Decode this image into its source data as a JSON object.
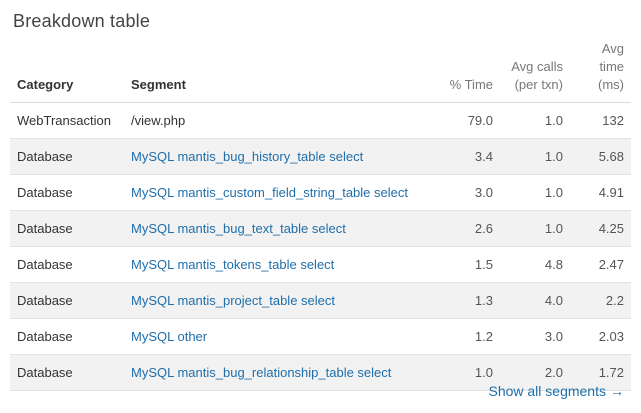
{
  "title": "Breakdown table",
  "columns": {
    "category": "Category",
    "segment": "Segment",
    "pct_time": "% Time",
    "avg_calls_line1": "Avg calls",
    "avg_calls_line2": "(per txn)",
    "avg_time_line1": "Avg",
    "avg_time_line2": "time (ms)"
  },
  "rows": [
    {
      "category": "WebTransaction",
      "segment": "/view.php",
      "segment_is_link": false,
      "pct_time": "79.0",
      "avg_calls": "1.0",
      "avg_time": "132"
    },
    {
      "category": "Database",
      "segment": "MySQL mantis_bug_history_table select",
      "segment_is_link": true,
      "pct_time": "3.4",
      "avg_calls": "1.0",
      "avg_time": "5.68"
    },
    {
      "category": "Database",
      "segment": "MySQL mantis_custom_field_string_table select",
      "segment_is_link": true,
      "pct_time": "3.0",
      "avg_calls": "1.0",
      "avg_time": "4.91"
    },
    {
      "category": "Database",
      "segment": "MySQL mantis_bug_text_table select",
      "segment_is_link": true,
      "pct_time": "2.6",
      "avg_calls": "1.0",
      "avg_time": "4.25"
    },
    {
      "category": "Database",
      "segment": "MySQL mantis_tokens_table select",
      "segment_is_link": true,
      "pct_time": "1.5",
      "avg_calls": "4.8",
      "avg_time": "2.47"
    },
    {
      "category": "Database",
      "segment": "MySQL mantis_project_table select",
      "segment_is_link": true,
      "pct_time": "1.3",
      "avg_calls": "4.0",
      "avg_time": "2.2"
    },
    {
      "category": "Database",
      "segment": "MySQL other",
      "segment_is_link": true,
      "pct_time": "1.2",
      "avg_calls": "3.0",
      "avg_time": "2.03"
    },
    {
      "category": "Database",
      "segment": "MySQL mantis_bug_relationship_table select",
      "segment_is_link": true,
      "pct_time": "1.0",
      "avg_calls": "2.0",
      "avg_time": "1.72"
    }
  ],
  "show_all": {
    "label": "Show all segments",
    "arrow": "→"
  },
  "colors": {
    "link": "#1f6fab",
    "row_alt": "#f2f2f2",
    "border": "#e3e3e3"
  }
}
